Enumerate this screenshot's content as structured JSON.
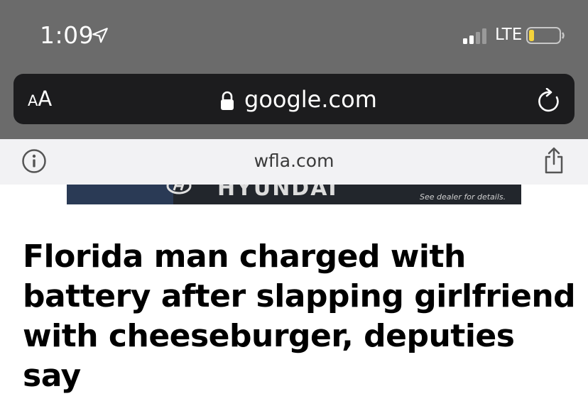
{
  "status_bar": {
    "time": "1:09",
    "network": "LTE",
    "location_icon": "location-arrow-icon",
    "signal_icon": "cellular-signal-icon",
    "battery_icon": "battery-low-icon",
    "battery_level_fraction": 0.15,
    "battery_color": "#f5d33b"
  },
  "browser": {
    "text_size_label_small": "A",
    "text_size_label_big": "A",
    "url": "google.com",
    "lock_icon": "lock-icon",
    "reload_icon": "reload-icon"
  },
  "site_bar": {
    "site_name": "wfla.com",
    "info_icon": "info-icon",
    "share_icon": "share-icon"
  },
  "ad": {
    "brand": "HYUNDAI",
    "fine_print": "See dealer for details."
  },
  "article": {
    "headline": "Florida man charged with battery after slapping girlfriend with cheeseburger, deputies say"
  },
  "colors": {
    "chrome_gray": "#6b6b6b",
    "url_bar_dark": "#1c1c1e",
    "site_bar_bg": "#f2f2f4"
  }
}
